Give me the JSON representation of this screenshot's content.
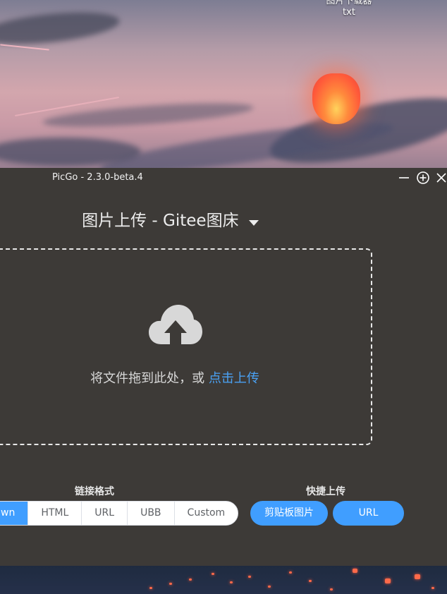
{
  "desktop": {
    "icon_label_line1": "图片下载器",
    "icon_label_line2": "txt"
  },
  "window": {
    "app_title": "PicGo - 2.3.0-beta.4",
    "controls": {
      "minimize_icon": "minimize-icon",
      "maximize_icon": "plus-circle-icon",
      "close_icon": "close-icon"
    }
  },
  "upload": {
    "picbed_title": "图片上传 - Gitee图床",
    "drop_text": "将文件拖到此处，或 ",
    "drop_link": "点击上传",
    "cloud_icon": "cloud-upload-icon",
    "link_color": "#4aa2f5"
  },
  "link_format": {
    "label": "链接格式",
    "options": [
      "wn",
      "HTML",
      "URL",
      "UBB",
      "Custom"
    ],
    "selected_index": 0,
    "accent": "#409eff"
  },
  "quick_upload": {
    "label": "快捷上传",
    "clipboard_button": "剪贴板图片",
    "url_button": "URL"
  }
}
